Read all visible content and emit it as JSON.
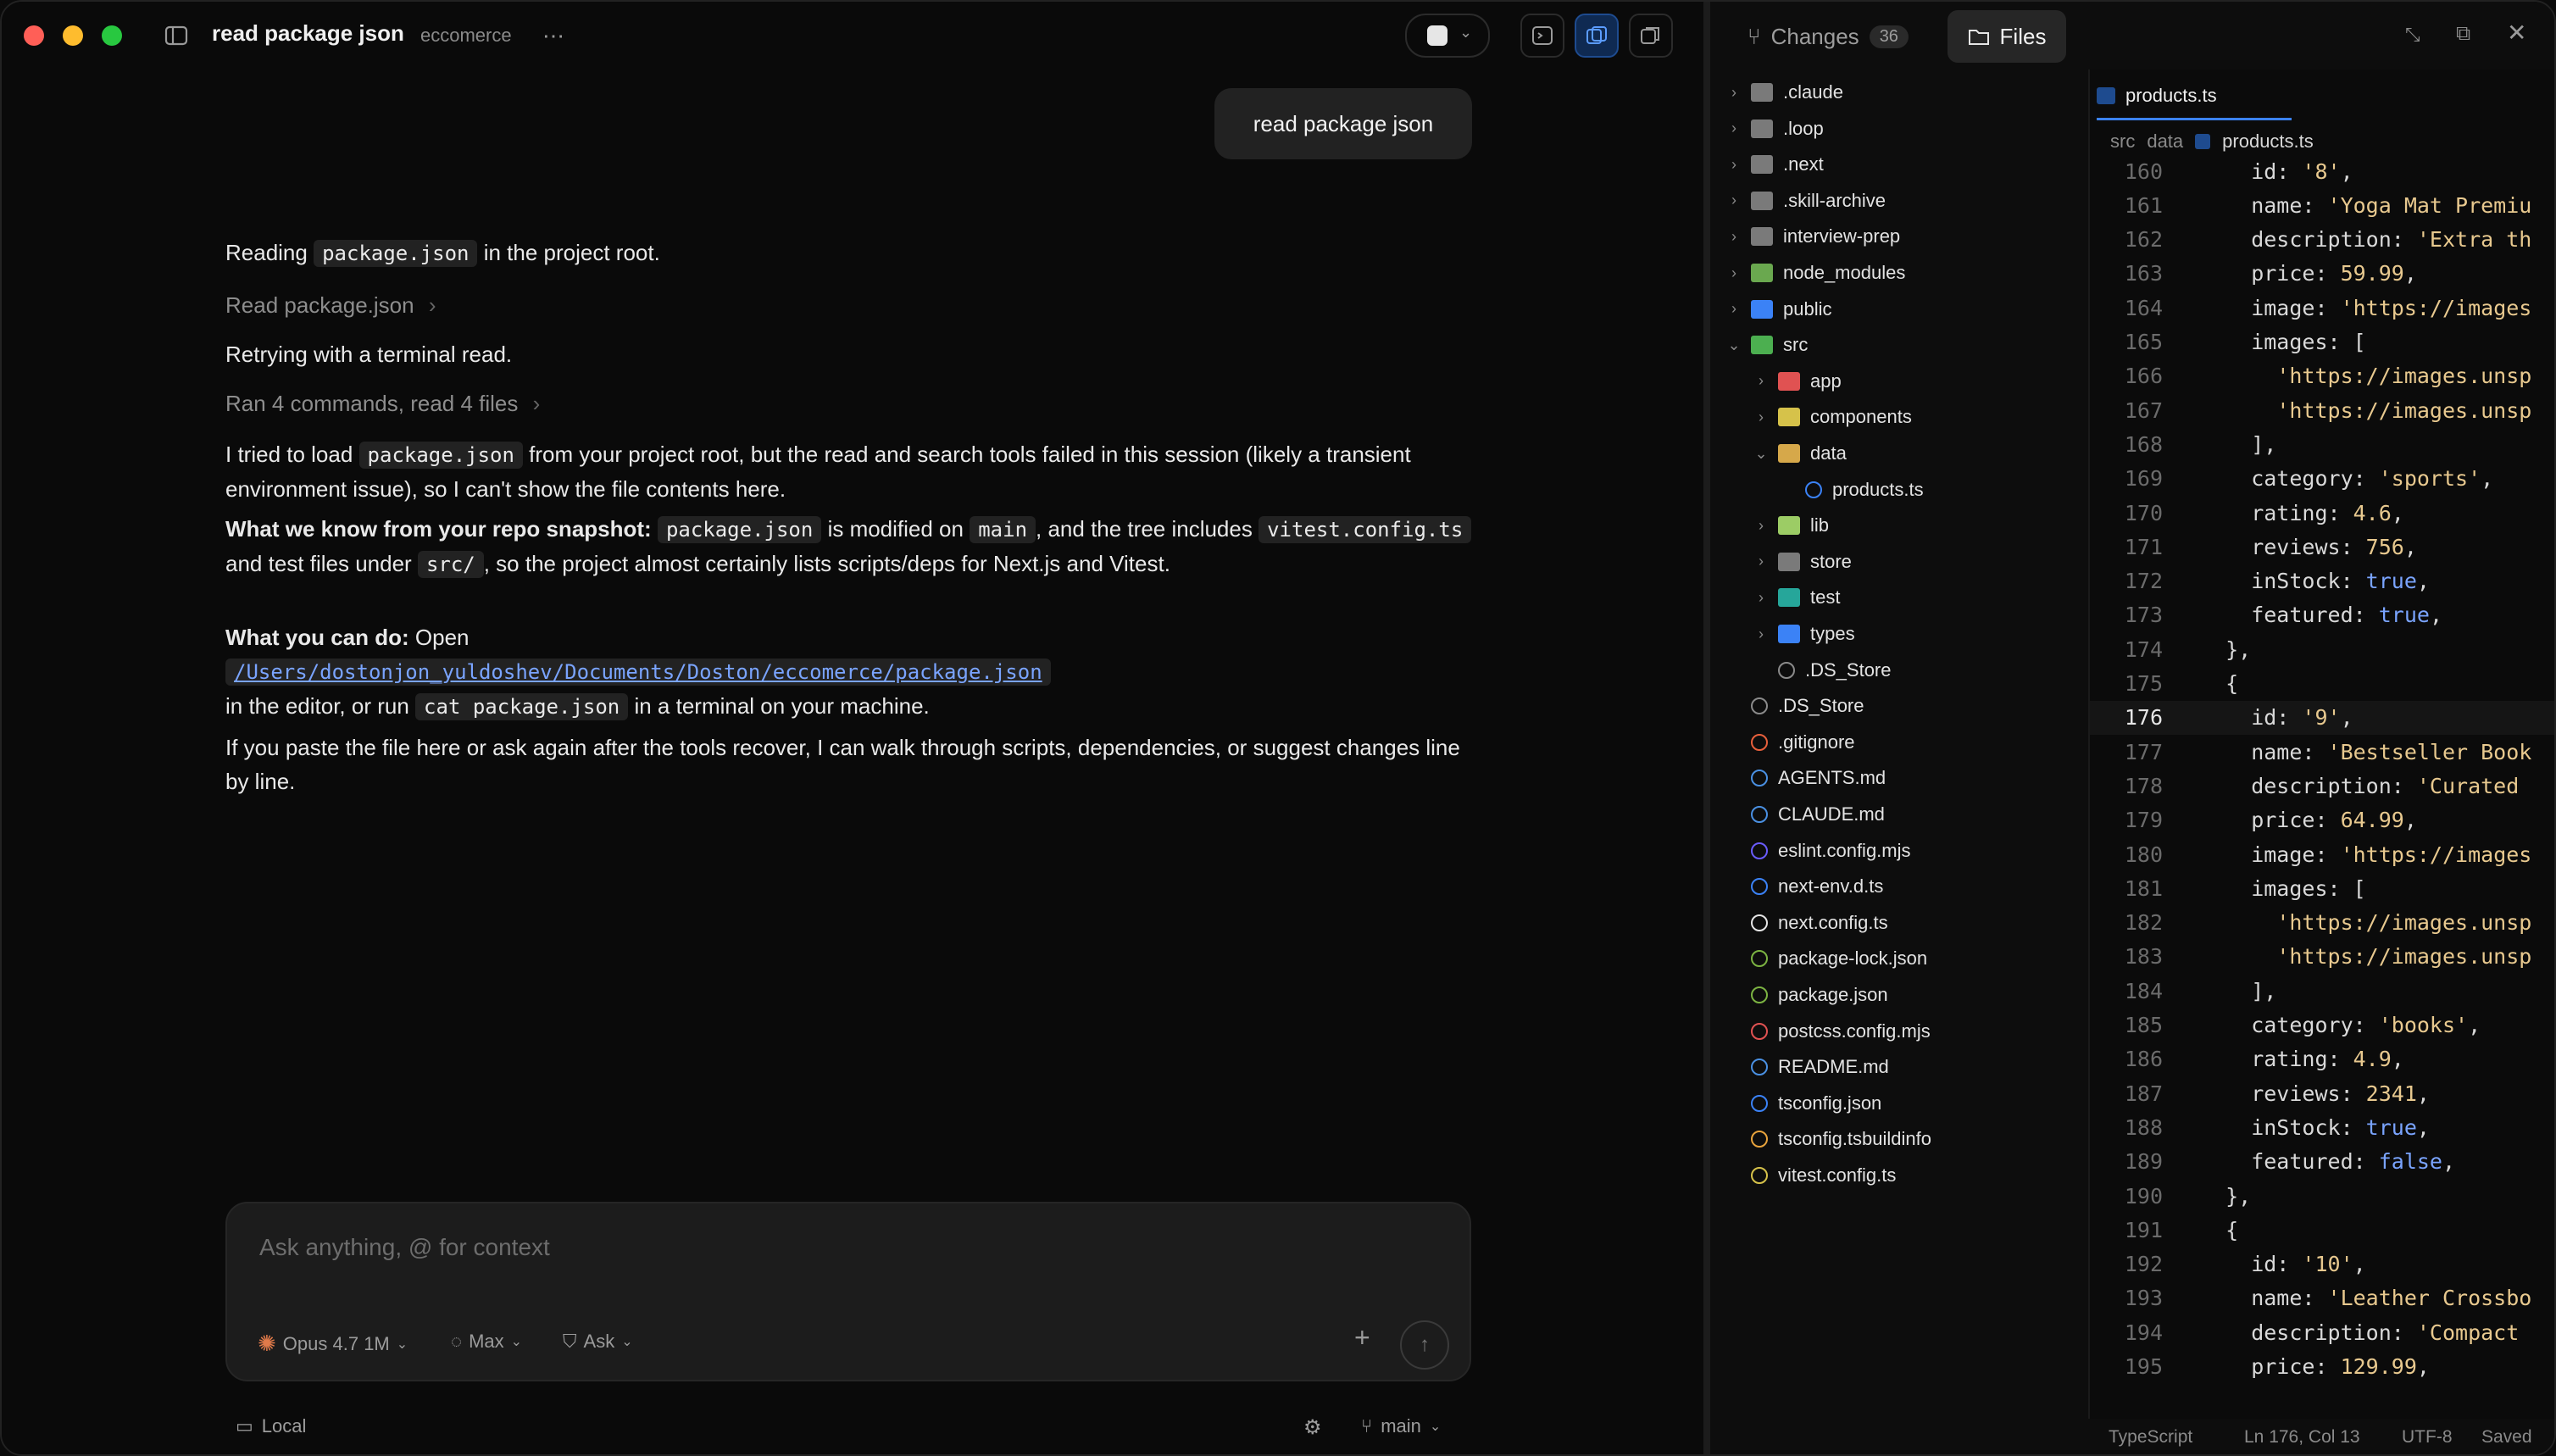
{
  "window": {
    "title": "read package json",
    "project": "eccomerce"
  },
  "chat": {
    "user_message": "read package json",
    "line1_pre": "Reading",
    "line1_code": "package.json",
    "line1_post": "in the project root.",
    "tool1": "Read package.json",
    "line2": "Retrying with a terminal read.",
    "tool2": "Ran 4 commands, read 4 files",
    "p1_a": "I tried to load",
    "p1_code": "package.json",
    "p1_b": "from your project root, but the read and search tools failed in this session (likely a transient environment issue), so I can't show the file contents here.",
    "p2_bold": "What we know from your repo snapshot:",
    "p2_code1": "package.json",
    "p2_a": "is modified on",
    "p2_code2": "main",
    "p2_b": ", and the tree includes",
    "p2_code3": "vitest.config.ts",
    "p2_c": "and test files under",
    "p2_code4": "src/",
    "p2_d": ", so the project almost certainly lists scripts/deps for Next.js and Vitest.",
    "p3_bold": "What you can do:",
    "p3_a": "Open",
    "p3_link": "/Users/dostonjon_yuldoshev/Documents/Doston/eccomerce/package.json",
    "p3_b": "in the editor, or run",
    "p3_code": "cat package.json",
    "p3_c": "in a terminal on your machine.",
    "p4": "If you paste the file here or ask again after the tools recover, I can walk through scripts, dependencies, or suggest changes line by line."
  },
  "composer": {
    "placeholder": "Ask anything, @ for context",
    "model": "Opus 4.7 1M",
    "effort": "Max",
    "mode": "Ask"
  },
  "footer": {
    "location": "Local",
    "branch": "main"
  },
  "panel": {
    "changes_label": "Changes",
    "changes_count": "36",
    "files_label": "Files"
  },
  "tree": [
    {
      "name": ".claude",
      "type": "folder",
      "depth": 0,
      "open": false
    },
    {
      "name": ".loop",
      "type": "folder",
      "depth": 0,
      "open": false
    },
    {
      "name": ".next",
      "type": "folder",
      "depth": 0,
      "open": false
    },
    {
      "name": ".skill-archive",
      "type": "folder",
      "depth": 0,
      "open": false
    },
    {
      "name": "interview-prep",
      "type": "folder",
      "depth": 0,
      "open": false
    },
    {
      "name": "node_modules",
      "type": "folder",
      "depth": 0,
      "open": false
    },
    {
      "name": "public",
      "type": "folder",
      "depth": 0,
      "open": false
    },
    {
      "name": "src",
      "type": "folder",
      "depth": 0,
      "open": true
    },
    {
      "name": "app",
      "type": "folder",
      "depth": 1,
      "open": false
    },
    {
      "name": "components",
      "type": "folder",
      "depth": 1,
      "open": false
    },
    {
      "name": "data",
      "type": "folder",
      "depth": 1,
      "open": true
    },
    {
      "name": "products.ts",
      "type": "file",
      "depth": 2
    },
    {
      "name": "lib",
      "type": "folder",
      "depth": 1,
      "open": false
    },
    {
      "name": "store",
      "type": "folder",
      "depth": 1,
      "open": false
    },
    {
      "name": "test",
      "type": "folder",
      "depth": 1,
      "open": false
    },
    {
      "name": "types",
      "type": "folder",
      "depth": 1,
      "open": false
    },
    {
      "name": ".DS_Store",
      "type": "file",
      "depth": 1
    },
    {
      "name": ".DS_Store",
      "type": "file",
      "depth": 0
    },
    {
      "name": ".gitignore",
      "type": "file",
      "depth": 0
    },
    {
      "name": "AGENTS.md",
      "type": "file",
      "depth": 0
    },
    {
      "name": "CLAUDE.md",
      "type": "file",
      "depth": 0
    },
    {
      "name": "eslint.config.mjs",
      "type": "file",
      "depth": 0
    },
    {
      "name": "next-env.d.ts",
      "type": "file",
      "depth": 0
    },
    {
      "name": "next.config.ts",
      "type": "file",
      "depth": 0
    },
    {
      "name": "package-lock.json",
      "type": "file",
      "depth": 0
    },
    {
      "name": "package.json",
      "type": "file",
      "depth": 0
    },
    {
      "name": "postcss.config.mjs",
      "type": "file",
      "depth": 0
    },
    {
      "name": "README.md",
      "type": "file",
      "depth": 0
    },
    {
      "name": "tsconfig.json",
      "type": "file",
      "depth": 0
    },
    {
      "name": "tsconfig.tsbuildinfo",
      "type": "file",
      "depth": 0
    },
    {
      "name": "vitest.config.ts",
      "type": "file",
      "depth": 0
    }
  ],
  "editor": {
    "tab": "products.ts",
    "breadcrumb": [
      "src",
      "data",
      "products.ts"
    ],
    "current_line": 176,
    "lines": [
      {
        "n": 160,
        "t": "    id: '8',"
      },
      {
        "n": 161,
        "t": "    name: 'Yoga Mat Premiu"
      },
      {
        "n": 162,
        "t": "    description: 'Extra th"
      },
      {
        "n": 163,
        "t": "    price: 59.99,"
      },
      {
        "n": 164,
        "t": "    image: 'https://images"
      },
      {
        "n": 165,
        "t": "    images: ["
      },
      {
        "n": 166,
        "t": "      'https://images.unsp"
      },
      {
        "n": 167,
        "t": "      'https://images.unsp"
      },
      {
        "n": 168,
        "t": "    ],"
      },
      {
        "n": 169,
        "t": "    category: 'sports',"
      },
      {
        "n": 170,
        "t": "    rating: 4.6,"
      },
      {
        "n": 171,
        "t": "    reviews: 756,"
      },
      {
        "n": 172,
        "t": "    inStock: true,"
      },
      {
        "n": 173,
        "t": "    featured: true,"
      },
      {
        "n": 174,
        "t": "  },"
      },
      {
        "n": 175,
        "t": "  {"
      },
      {
        "n": 176,
        "t": "    id: '9',"
      },
      {
        "n": 177,
        "t": "    name: 'Bestseller Book"
      },
      {
        "n": 178,
        "t": "    description: 'Curated "
      },
      {
        "n": 179,
        "t": "    price: 64.99,"
      },
      {
        "n": 180,
        "t": "    image: 'https://images"
      },
      {
        "n": 181,
        "t": "    images: ["
      },
      {
        "n": 182,
        "t": "      'https://images.unsp"
      },
      {
        "n": 183,
        "t": "      'https://images.unsp"
      },
      {
        "n": 184,
        "t": "    ],"
      },
      {
        "n": 185,
        "t": "    category: 'books',"
      },
      {
        "n": 186,
        "t": "    rating: 4.9,"
      },
      {
        "n": 187,
        "t": "    reviews: 2341,"
      },
      {
        "n": 188,
        "t": "    inStock: true,"
      },
      {
        "n": 189,
        "t": "    featured: false,"
      },
      {
        "n": 190,
        "t": "  },"
      },
      {
        "n": 191,
        "t": "  {"
      },
      {
        "n": 192,
        "t": "    id: '10',"
      },
      {
        "n": 193,
        "t": "    name: 'Leather Crossbo"
      },
      {
        "n": 194,
        "t": "    description: 'Compact "
      },
      {
        "n": 195,
        "t": "    price: 129.99,"
      }
    ]
  },
  "status": {
    "language": "TypeScript",
    "position": "Ln 176, Col 13",
    "encoding": "UTF-8",
    "save_state": "Saved"
  }
}
